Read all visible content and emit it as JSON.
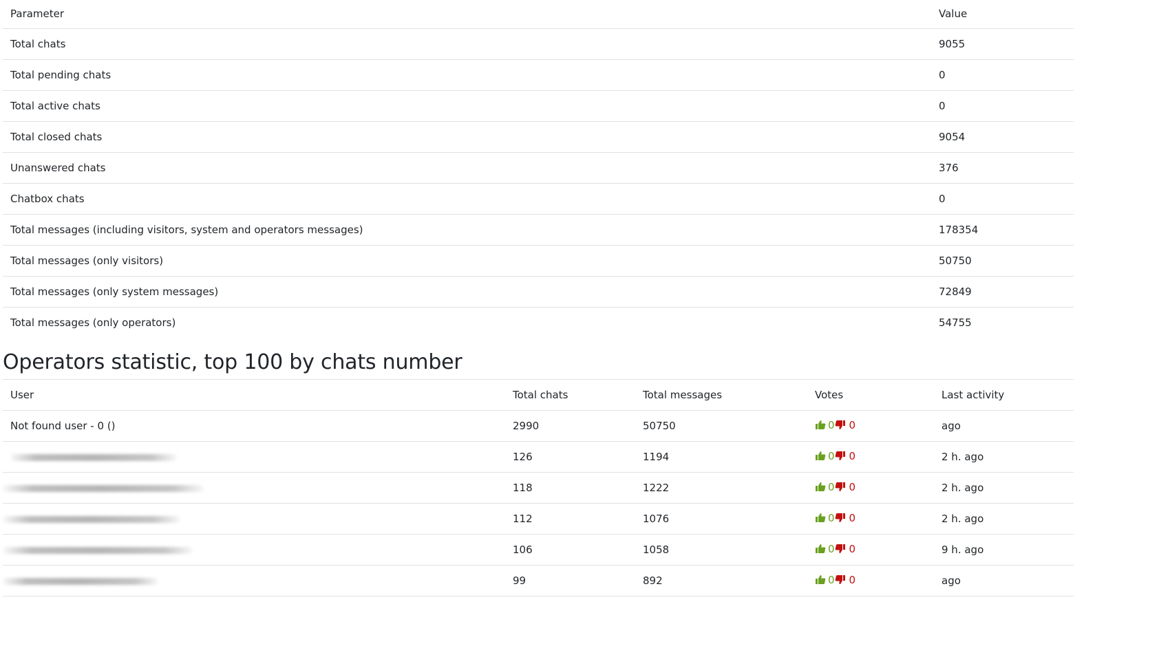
{
  "summary": {
    "headers": {
      "parameter": "Parameter",
      "value": "Value"
    },
    "rows": [
      {
        "label": "Total chats",
        "value": "9055"
      },
      {
        "label": "Total pending chats",
        "value": "0"
      },
      {
        "label": "Total active chats",
        "value": "0"
      },
      {
        "label": "Total closed chats",
        "value": "9054"
      },
      {
        "label": "Unanswered chats",
        "value": "376"
      },
      {
        "label": "Chatbox chats",
        "value": "0"
      },
      {
        "label": "Total messages (including visitors, system and operators messages)",
        "value": "178354"
      },
      {
        "label": "Total messages (only visitors)",
        "value": "50750"
      },
      {
        "label": "Total messages (only system messages)",
        "value": "72849"
      },
      {
        "label": "Total messages (only operators)",
        "value": "54755"
      }
    ]
  },
  "operators": {
    "title": "Operators statistic, top 100 by chats number",
    "headers": {
      "user": "User",
      "total_chats": "Total chats",
      "total_messages": "Total messages",
      "votes": "Votes",
      "last_activity": "Last activity"
    },
    "rows": [
      {
        "user": "Not found user - 0 ()",
        "total_chats": "2990",
        "total_messages": "50750",
        "votes_up": "0",
        "votes_down": "0",
        "last_activity": "ago"
      },
      {
        "user": "",
        "total_chats": "126",
        "total_messages": "1194",
        "votes_up": "0",
        "votes_down": "0",
        "last_activity": "2 h. ago"
      },
      {
        "user": "",
        "total_chats": "118",
        "total_messages": "1222",
        "votes_up": "0",
        "votes_down": "0",
        "last_activity": "2 h. ago"
      },
      {
        "user": "",
        "total_chats": "112",
        "total_messages": "1076",
        "votes_up": "0",
        "votes_down": "0",
        "last_activity": "2 h. ago"
      },
      {
        "user": "",
        "total_chats": "106",
        "total_messages": "1058",
        "votes_up": "0",
        "votes_down": "0",
        "last_activity": "9 h. ago"
      },
      {
        "user": "",
        "total_chats": "99",
        "total_messages": "892",
        "votes_up": "0",
        "votes_down": "0",
        "last_activity": "ago"
      }
    ]
  },
  "icons": {
    "vote_up": "thumbs-up-icon",
    "vote_down": "thumbs-down-icon"
  },
  "colors": {
    "vote_up": "#6aa121",
    "vote_down": "#c21010",
    "border": "#dee2e6",
    "text": "#212529"
  }
}
